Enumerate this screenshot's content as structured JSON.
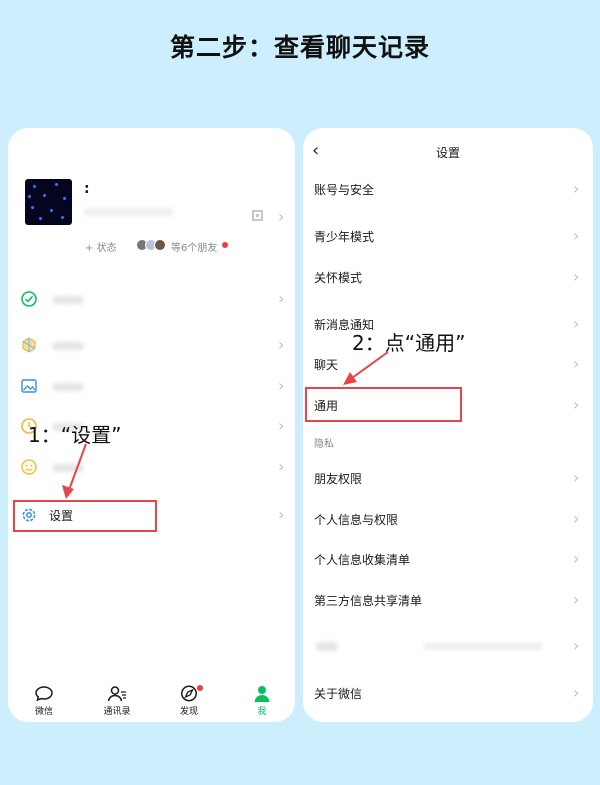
{
  "page_title": "第二步：查看聊天记录",
  "colors": {
    "background": "#cdeefc",
    "wechat_green": "#07c160",
    "highlight_red": "#e5464a"
  },
  "left_phone": {
    "profile": {
      "name": ":",
      "status_button": "+ 状态",
      "friends_text": "等6个朋友"
    },
    "menu": [
      {
        "icon": "pay-service-icon",
        "label": ""
      },
      {
        "icon": "favorites-icon",
        "label": ""
      },
      {
        "icon": "moments-icon",
        "label": ""
      },
      {
        "icon": "cards-icon",
        "label": ""
      },
      {
        "icon": "stickers-icon",
        "label": ""
      },
      {
        "icon": "settings-gear-icon",
        "label": "设置"
      }
    ],
    "tabbar": [
      {
        "icon": "chat-bubble-icon",
        "label": "微信"
      },
      {
        "icon": "contacts-icon",
        "label": "通讯录"
      },
      {
        "icon": "compass-icon",
        "label": "发现"
      },
      {
        "icon": "person-icon",
        "label": "我"
      }
    ]
  },
  "right_phone": {
    "back_icon": "back-arrow-icon",
    "title": "设置",
    "items": [
      "账号与安全",
      "青少年模式",
      "关怀模式",
      "新消息通知",
      "聊天",
      "通用",
      "朋友权限",
      "个人信息与权限",
      "个人信息收集清单",
      "第三方信息共享清单",
      "关于微信"
    ],
    "section_privacy": "隐私"
  },
  "annotations": {
    "step1": "1：“设置”",
    "step2": "2：点“通用”"
  }
}
